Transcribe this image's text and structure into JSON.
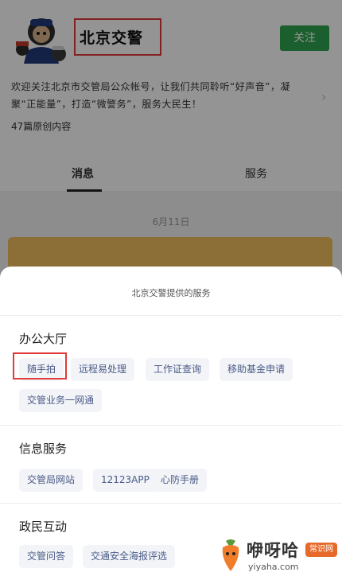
{
  "profile": {
    "account_name": "北京交警",
    "follow_label": "关注",
    "description": "欢迎关注北京市交管局公众帐号，让我们共同聆听“好声音”，凝聚“正能量”，打造“微警务”，服务大民生！",
    "article_count": "47篇原创内容",
    "tabs": [
      {
        "label": "消息"
      },
      {
        "label": "服务"
      }
    ],
    "date_label": "6月11日"
  },
  "sheet": {
    "title": "北京交警提供的服务",
    "sections": [
      {
        "title": "办公大厅",
        "items": [
          "随手拍",
          "远程易处理",
          "工作证查询",
          "移助基金申请",
          "交管业务一网通"
        ]
      },
      {
        "title": "信息服务",
        "items": [
          "交管局网站",
          "12123APP",
          "心防手册"
        ]
      },
      {
        "title": "政民互动",
        "items": [
          "交管问答",
          "交通安全海报评选"
        ]
      }
    ]
  },
  "watermark": {
    "title": "咿呀哈",
    "badge": "常识网",
    "url": "yiyaha.com"
  }
}
